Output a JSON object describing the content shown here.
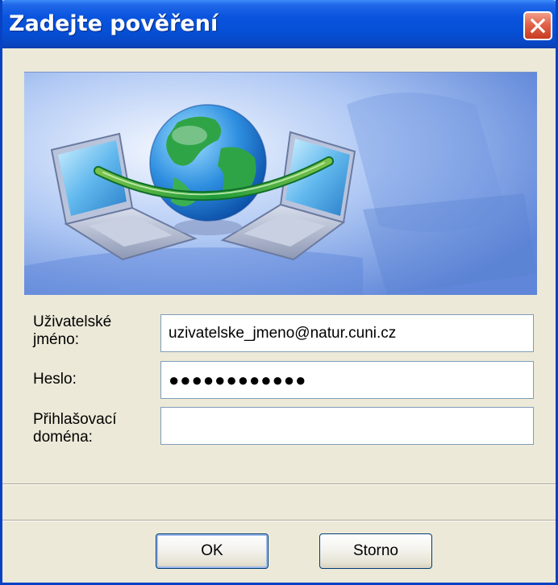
{
  "window": {
    "title": "Zadejte pověření",
    "close_label": "Zavřít"
  },
  "form": {
    "username_label_line1": "Uživatelské",
    "username_label_line2": "jméno:",
    "username_value": "uzivatelske_jmeno@natur.cuni.cz",
    "password_label": "Heslo:",
    "password_mask": "●●●●●●●●●●●●",
    "domain_label_line1": "Přihlašovací",
    "domain_label_line2": "doména:",
    "domain_value": ""
  },
  "buttons": {
    "ok_label": "OK",
    "cancel_label": "Storno"
  },
  "colors": {
    "titlebar": "#0A54DE",
    "dialog_bg": "#ECE9D8",
    "close_button": "#E2624A"
  },
  "icons": {
    "banner": "network-globe-laptops-illustration",
    "close": "close-icon"
  }
}
